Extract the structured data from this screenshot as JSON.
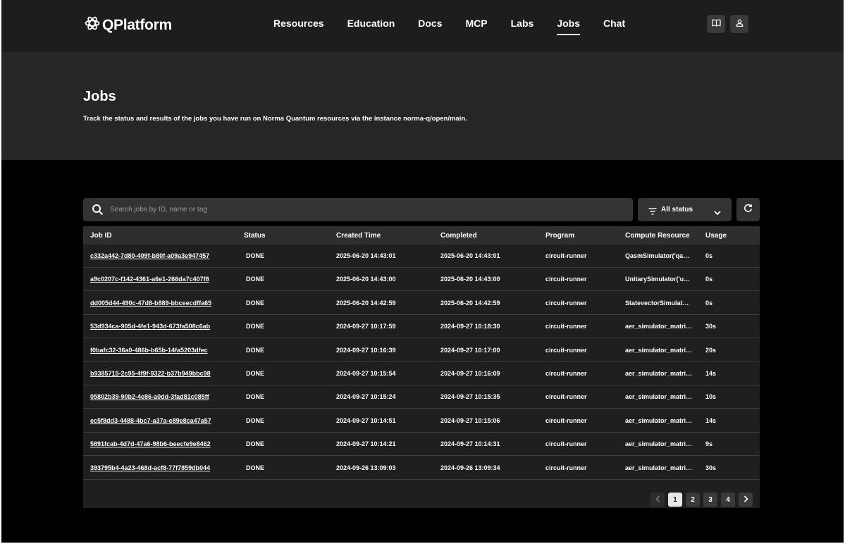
{
  "header": {
    "logo_text": "QPlatform",
    "nav": [
      "Resources",
      "Education",
      "Docs",
      "MCP",
      "Labs",
      "Jobs",
      "Chat"
    ],
    "active_nav": "Jobs"
  },
  "hero": {
    "title": "Jobs",
    "description": "Track the status and results of the jobs you have run on Norma Quantum resources via the instance norma-q/open/main."
  },
  "toolbar": {
    "search_placeholder": "Search jobs by ID, name or tag",
    "status_filter": "All status"
  },
  "table": {
    "columns": [
      "Job ID",
      "Status",
      "Created Time",
      "Completed",
      "Program",
      "Compute Resource",
      "Usage"
    ],
    "rows": [
      {
        "id": "c332a442-7d80-409f-b80f-a09a3e947457",
        "status": "DONE",
        "created": "2025-06-20 14:43:01",
        "completed": "2025-06-20 14:43:01",
        "program": "circuit-runner",
        "resource": "QasmSimulator('qasm_simulator')",
        "usage": "0s"
      },
      {
        "id": "a9c0207c-f142-4361-a6e1-266da7c407f8",
        "status": "DONE",
        "created": "2025-06-20 14:43:00",
        "completed": "2025-06-20 14:43:00",
        "program": "circuit-runner",
        "resource": "UnitarySimulator('unitary_simulator')",
        "usage": "0s"
      },
      {
        "id": "dd005d44-490c-47d8-b889-bbceecdffa65",
        "status": "DONE",
        "created": "2025-06-20 14:42:59",
        "completed": "2025-06-20 14:42:59",
        "program": "circuit-runner",
        "resource": "StatevectorSimulator('statevector_simulator')",
        "usage": "0s"
      },
      {
        "id": "53d934ca-905d-4fe1-943d-673fa508c6ab",
        "status": "DONE",
        "created": "2024-09-27 10:17:59",
        "completed": "2024-09-27 10:18:30",
        "program": "circuit-runner",
        "resource": "aer_simulator_matrix_product_state",
        "usage": "30s"
      },
      {
        "id": "f0bafc32-36a0-486b-b65b-14fa5203dfec",
        "status": "DONE",
        "created": "2024-09-27 10:16:39",
        "completed": "2024-09-27 10:17:00",
        "program": "circuit-runner",
        "resource": "aer_simulator_matrix_product_state",
        "usage": "20s"
      },
      {
        "id": "b9385715-2c95-4f9f-9322-b37b949bbc98",
        "status": "DONE",
        "created": "2024-09-27 10:15:54",
        "completed": "2024-09-27 10:16:09",
        "program": "circuit-runner",
        "resource": "aer_simulator_matrix_product_state",
        "usage": "14s"
      },
      {
        "id": "05802b39-90b2-4e86-a0dd-3fad81c085ff",
        "status": "DONE",
        "created": "2024-09-27 10:15:24",
        "completed": "2024-09-27 10:15:35",
        "program": "circuit-runner",
        "resource": "aer_simulator_matrix_product_state",
        "usage": "10s"
      },
      {
        "id": "ec5f8dd3-4488-4bc7-a37a-e89e8ca47a57",
        "status": "DONE",
        "created": "2024-09-27 10:14:51",
        "completed": "2024-09-27 10:15:06",
        "program": "circuit-runner",
        "resource": "aer_simulator_matrix_product_state",
        "usage": "14s"
      },
      {
        "id": "5891fcab-4d7d-47a6-98b6-beecfe9e8462",
        "status": "DONE",
        "created": "2024-09-27 10:14:21",
        "completed": "2024-09-27 10:14:31",
        "program": "circuit-runner",
        "resource": "aer_simulator_matrix_product_state",
        "usage": "9s"
      },
      {
        "id": "393795b4-4a23-468d-acf8-77f7859db044",
        "status": "DONE",
        "created": "2024-09-26 13:09:03",
        "completed": "2024-09-26 13:09:34",
        "program": "circuit-runner",
        "resource": "aer_simulator_matrix_product_state",
        "usage": "30s"
      }
    ]
  },
  "pagination": {
    "pages": [
      "1",
      "2",
      "3",
      "4"
    ],
    "current": "1",
    "prev_icon": "chevron-left-icon",
    "next_icon": "chevron-right-icon"
  },
  "icons": {
    "logo": "atom-logo-icon",
    "docs": "book-icon",
    "account": "user-icon",
    "search": "search-icon",
    "filter": "filter-icon",
    "dropdown": "chevron-down-icon",
    "refresh": "refresh-icon"
  },
  "colors": {
    "background": "#000000",
    "header": "#1d1d1d",
    "hero": "#262626",
    "table": "#1f1f1f",
    "table_header": "#2e2e2e",
    "control": "#333333"
  }
}
